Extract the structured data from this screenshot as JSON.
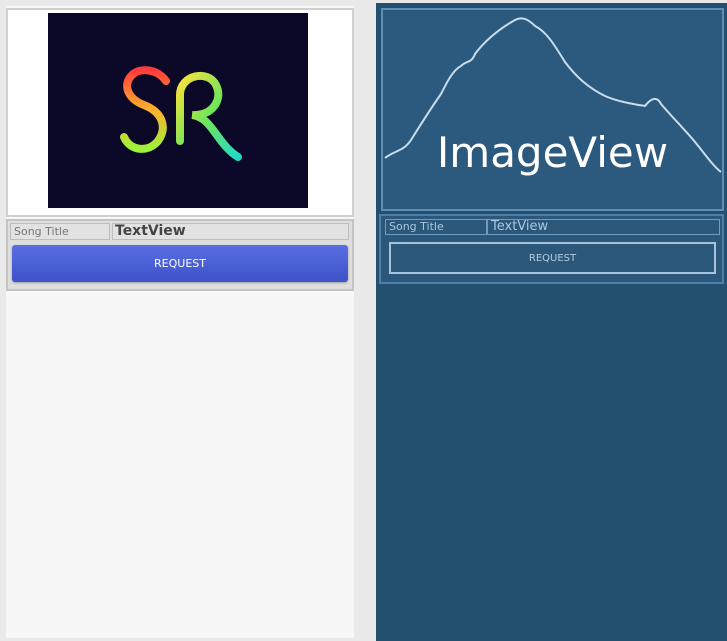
{
  "design": {
    "song_title_label": "Song Title",
    "text_view_label": "TextView",
    "request_button": "REQUEST"
  },
  "blueprint": {
    "image_view_label": "ImageView",
    "song_title_label": "Song Title",
    "text_view_label": "TextView",
    "request_button": "REQUEST"
  },
  "icons": {
    "logo": "sr-logo-icon",
    "image_placeholder": "mountain-icon"
  },
  "colors": {
    "button_blue": "#4a5fd6",
    "blueprint_bg": "#24506f",
    "logo_bg": "#0c0827"
  }
}
